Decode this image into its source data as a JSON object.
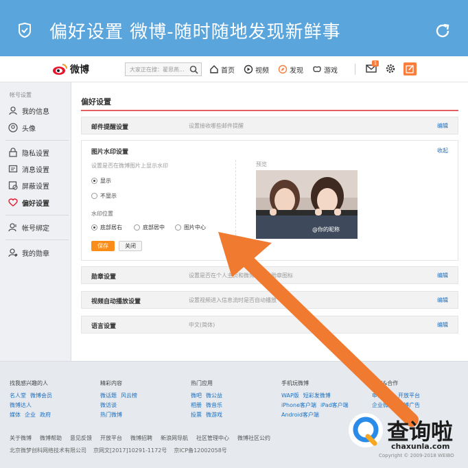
{
  "appbar": {
    "title": "偏好设置 微博-随时随地发现新鲜事"
  },
  "topnav": {
    "logo": "微博",
    "search_placeholder": "大家正在搜：翟思燕...",
    "items": [
      {
        "label": "首页",
        "icon": "home-icon"
      },
      {
        "label": "视频",
        "icon": "video-icon"
      },
      {
        "label": "发现",
        "icon": "discover-icon"
      },
      {
        "label": "游戏",
        "icon": "game-icon"
      }
    ],
    "mail_badge": "1"
  },
  "sidebar": {
    "group_label": "帐号设置",
    "items": [
      {
        "label": "我的信息",
        "icon": "user-icon"
      },
      {
        "label": "头像",
        "icon": "avatar-icon"
      },
      {
        "label": "隐私设置",
        "icon": "lock-icon"
      },
      {
        "label": "消息设置",
        "icon": "message-icon"
      },
      {
        "label": "屏蔽设置",
        "icon": "block-icon"
      },
      {
        "label": "偏好设置",
        "icon": "heart-icon",
        "active": true
      },
      {
        "label": "帐号绑定",
        "icon": "bind-icon"
      },
      {
        "label": "我的勋章",
        "icon": "medal-icon"
      }
    ]
  },
  "main": {
    "heading": "偏好设置",
    "rows": [
      {
        "label": "邮件提醒设置",
        "desc": "设置接收哪些邮件提醒",
        "edit": "编辑"
      },
      {
        "label": "勋章设置",
        "desc": "设置是否在个人主页和微博中显示勋章图标",
        "edit": "编辑"
      },
      {
        "label": "视频自动播放设置",
        "desc": "设置视频进入信息流时是否自动播放",
        "edit": "编辑"
      },
      {
        "label": "语言设置",
        "desc": "中文(简体)",
        "edit": "编辑"
      }
    ],
    "watermark_panel": {
      "title": "图片水印设置",
      "collapse": "收起",
      "hint": "设置是否在微博图片上显示水印",
      "show": "显示",
      "hide": "不显示",
      "position_label": "水印位置",
      "positions": [
        "底部居右",
        "底部居中",
        "图片中心"
      ],
      "save": "保存",
      "close": "关闭",
      "preview": "预览",
      "preview_watermark": "@你的昵称"
    }
  },
  "footer": {
    "columns": [
      {
        "title": "找我感兴趣的人",
        "links": [
          [
            "名人堂",
            "微博会员"
          ],
          [
            "微博达人"
          ],
          [
            "媒体",
            "企业",
            "政府"
          ]
        ]
      },
      {
        "title": "精彩内容",
        "links": [
          [
            "微话题",
            "风云榜"
          ],
          [
            "微访谈"
          ],
          [
            "热门微博"
          ]
        ]
      },
      {
        "title": "热门应用",
        "links": [
          [
            "微吧",
            "微公益"
          ],
          [
            "相册",
            "微音乐"
          ],
          [
            "投票",
            "微游戏"
          ]
        ]
      },
      {
        "title": "手机玩微博",
        "links": [
          [
            "WAP版",
            "短彩发微博"
          ],
          [
            "iPhone客户端",
            "iPad客户端"
          ],
          [
            "Android客户端"
          ]
        ]
      },
      {
        "title": "认证&合作",
        "links": [
          [
            "申请认证",
            "开放平台"
          ],
          [
            "企业微博",
            "微博广告"
          ]
        ]
      }
    ],
    "bar_links": [
      "关于微博",
      "微博帮助",
      "意见反馈",
      "开放平台",
      "微博招聘",
      "新浪网导航",
      "社区管理中心",
      "微博社区公约"
    ],
    "copyright": [
      "北京微梦创科网络技术有限公司",
      "京网文[2017]10291-1172号",
      "京ICP备12002058号"
    ]
  },
  "watermark": {
    "brand_cn": "查询啦",
    "url": "chaxunla.com",
    "copyright": "Copyright © 2009-2018 WEIBO"
  },
  "colors": {
    "appbar": "#5aa5dc",
    "accent": "#fa7d3c",
    "arrow": "#f07a30",
    "link": "#1b6fc2"
  }
}
